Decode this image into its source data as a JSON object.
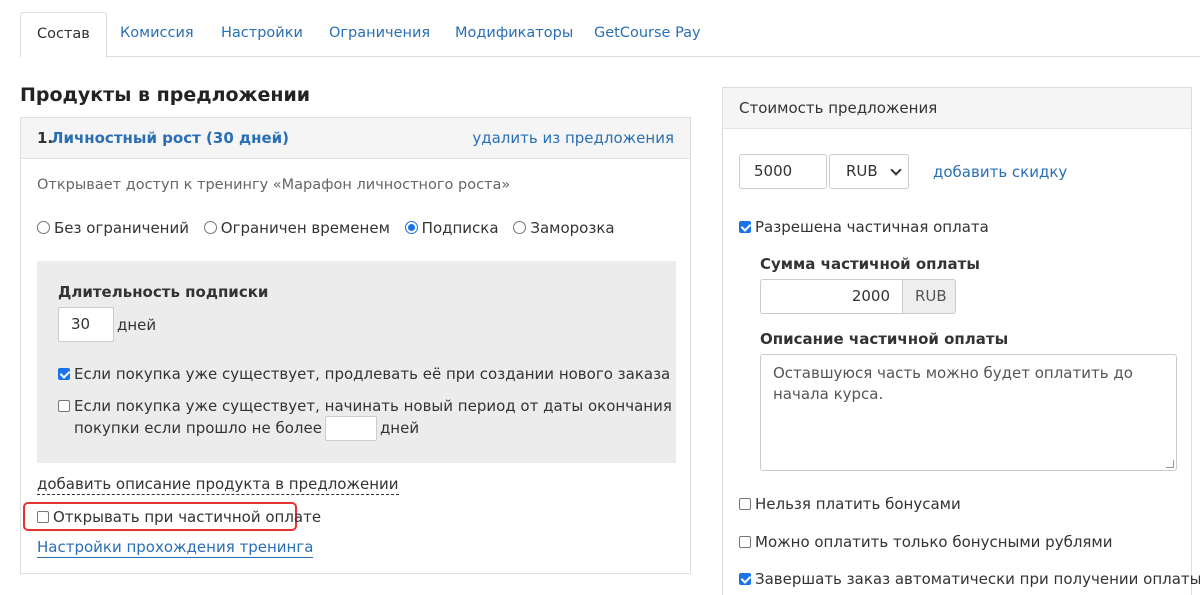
{
  "tabs": [
    "Состав",
    "Комиссия",
    "Настройки",
    "Ограничения",
    "Модификаторы",
    "GetCourse Pay"
  ],
  "section_title": "Продукты в предложении",
  "product": {
    "number": "1.",
    "name": "Личностный рост (30 дней)",
    "remove_label": "удалить из предложения",
    "description": "Открывает доступ к тренингу «Марафон личностного роста»",
    "access_options": [
      "Без ограничений",
      "Ограничен временем",
      "Подписка",
      "Заморозка"
    ],
    "selected_option": "Подписка",
    "subscription": {
      "duration_label": "Длительность подписки",
      "duration_value": "30",
      "duration_unit": "дней",
      "extend_label": "Если покупка уже существует, продлевать её при создании нового заказа",
      "extend_checked": true,
      "new_period_label_line1": "Если покупка уже существует, начинать новый период от даты окончания",
      "new_period_label_line2": "покупки если прошло не более",
      "new_period_value": "",
      "new_period_unit": "дней",
      "new_period_checked": false
    },
    "add_description_link": "добавить описание продукта в предложении",
    "open_on_partial_label": "Открывать при частичной оплате",
    "open_on_partial_checked": false,
    "training_settings_link": "Настройки прохождения тренинга"
  },
  "cost": {
    "title": "Стоимость предложения",
    "price": "5000",
    "currency": "RUB",
    "add_discount_link": "добавить скидку",
    "partial_allowed_label": "Разрешена частичная оплата",
    "partial_allowed_checked": true,
    "partial_amount_label": "Сумма частичной оплаты",
    "partial_amount_value": "2000",
    "partial_amount_currency": "RUB",
    "partial_desc_label": "Описание частичной оплаты",
    "partial_desc_value": "Оставшуюся часть можно будет оплатить до начала курса.",
    "no_bonus_label": "Нельзя платить бонусами",
    "no_bonus_checked": false,
    "only_bonus_label": "Можно оплатить только бонусными рублями",
    "only_bonus_checked": false,
    "auto_complete_label": "Завершать заказ автоматически при получении оплаты",
    "auto_complete_checked": true
  },
  "colors": {
    "link": "#2a6fb5",
    "accent": "#1a73e8",
    "highlight": "#e3342f"
  }
}
